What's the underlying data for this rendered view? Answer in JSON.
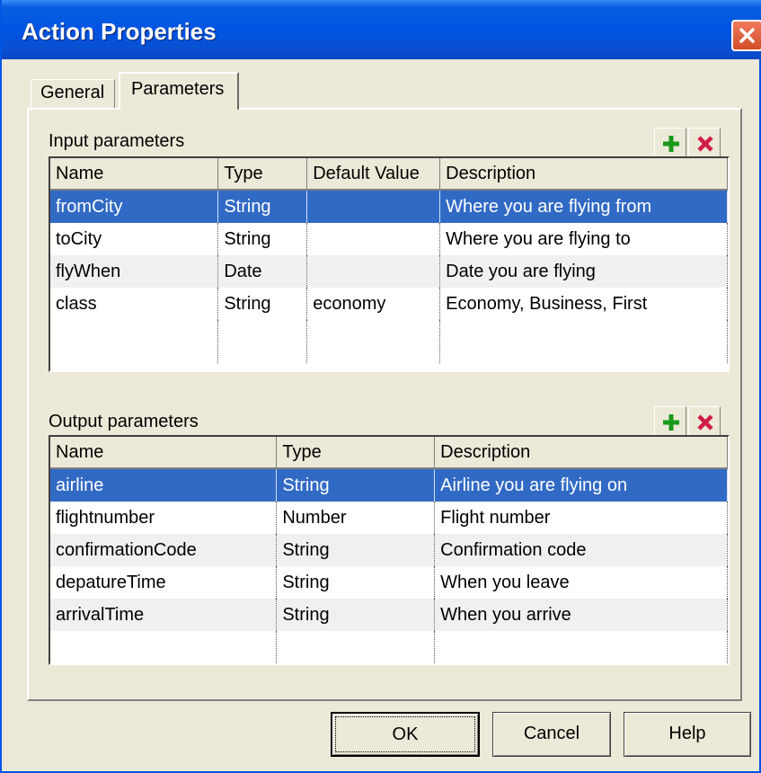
{
  "window": {
    "title": "Action Properties"
  },
  "tabs": [
    {
      "label": "General"
    },
    {
      "label": "Parameters"
    }
  ],
  "input_section": {
    "label": "Input parameters",
    "columns": [
      "Name",
      "Type",
      "Default Value",
      "Description"
    ],
    "rows": [
      [
        "fromCity",
        "String",
        "",
        "Where you are flying from"
      ],
      [
        "toCity",
        "String",
        "",
        "Where you are flying to"
      ],
      [
        "flyWhen",
        "Date",
        "",
        "Date you are flying"
      ],
      [
        "class",
        "String",
        "economy",
        "Economy, Business, First"
      ]
    ],
    "selected_row": 0
  },
  "output_section": {
    "label": "Output parameters",
    "columns": [
      "Name",
      "Type",
      "Description"
    ],
    "rows": [
      [
        "airline",
        "String",
        "Airline you are flying on"
      ],
      [
        "flightnumber",
        "Number",
        "Flight number"
      ],
      [
        "confirmationCode",
        "String",
        "Confirmation code"
      ],
      [
        "depatureTime",
        "String",
        "When you leave"
      ],
      [
        "arrivalTime",
        "String",
        "When you arrive"
      ]
    ],
    "selected_row": 0
  },
  "toolbar_icons": {
    "add": "plus-icon",
    "remove": "x-icon"
  },
  "colors": {
    "selection": "#316ac5",
    "add_icon": "#1a9a1a",
    "remove_icon": "#d01c48",
    "titlebar": "#0054e3"
  },
  "buttons": {
    "ok": "OK",
    "cancel": "Cancel",
    "help": "Help"
  }
}
